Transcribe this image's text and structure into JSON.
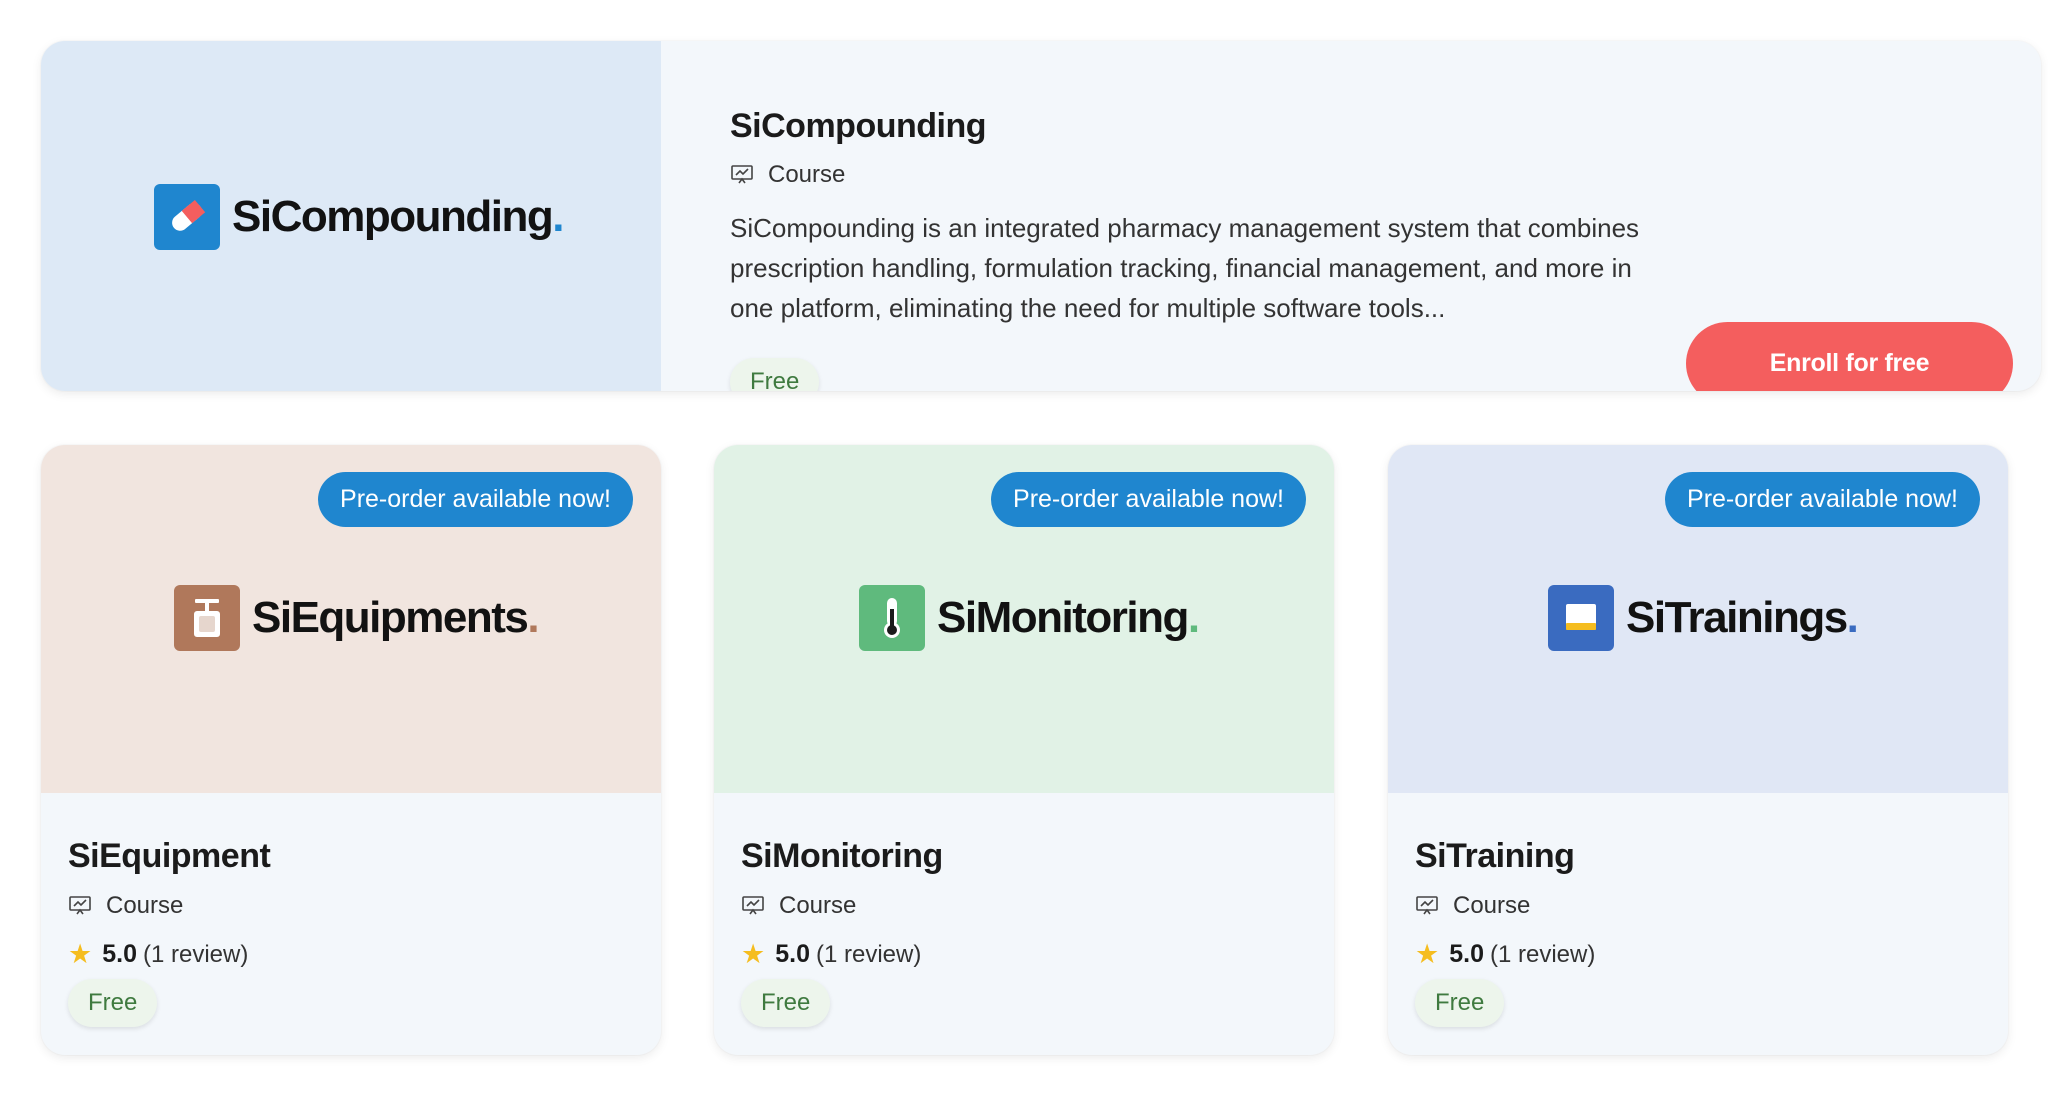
{
  "featured": {
    "logo_text": "SiCompounding",
    "logo_dot": ".",
    "logo_icon": "pill-icon",
    "title": "SiCompounding",
    "type_label": "Course",
    "description": "SiCompounding is an integrated pharmacy management system that combines prescription handling, formulation tracking, financial management, and more in one platform, eliminating the need for multiple software tools...",
    "price": "Free",
    "enroll_label": "Enroll for free",
    "media_bg": "#dde9f6",
    "accent": "#1f86cf"
  },
  "cards": [
    {
      "logo_text": "SiEquipments",
      "logo_dot": ".",
      "logo_icon": "scale-icon",
      "preorder_label": "Pre-order available now!",
      "title": "SiEquipment",
      "type_label": "Course",
      "rating": "5.0",
      "reviews": "(1 review)",
      "price": "Free",
      "media_bg": "#f1e5df",
      "accent": "#b0785b"
    },
    {
      "logo_text": "SiMonitoring",
      "logo_dot": ".",
      "logo_icon": "thermometer-icon",
      "preorder_label": "Pre-order available now!",
      "title": "SiMonitoring",
      "type_label": "Course",
      "rating": "5.0",
      "reviews": "(1 review)",
      "price": "Free",
      "media_bg": "#e1f2e6",
      "accent": "#5fba7d"
    },
    {
      "logo_text": "SiTrainings",
      "logo_dot": ".",
      "logo_icon": "screen-icon",
      "preorder_label": "Pre-order available now!",
      "title": "SiTraining",
      "type_label": "Course",
      "rating": "5.0",
      "reviews": "(1 review)",
      "price": "Free",
      "media_bg": "#e0e7f5",
      "accent": "#3a6bc0"
    }
  ],
  "colors": {
    "enroll": "#f45e5e",
    "preorder": "#1f86cf",
    "star": "#f5bd1f",
    "free_badge_bg": "#edf5ec",
    "free_badge_text": "#3f7a3f"
  }
}
